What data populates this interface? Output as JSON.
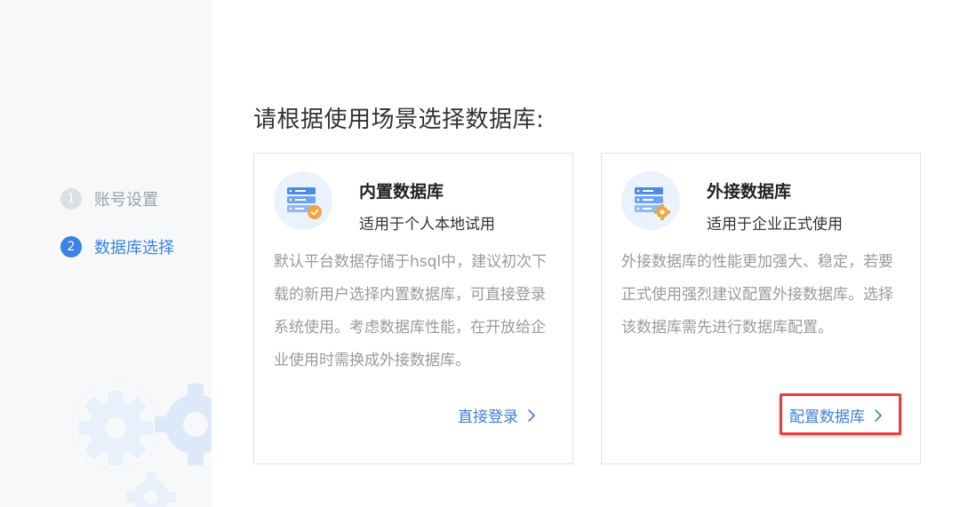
{
  "steps": [
    {
      "number": "1",
      "label": "账号设置",
      "state": "inactive"
    },
    {
      "number": "2",
      "label": "数据库选择",
      "state": "active"
    }
  ],
  "main": {
    "title": "请根据使用场景选择数据库:"
  },
  "cards": [
    {
      "title": "内置数据库",
      "subtitle": "适用于个人本地试用",
      "icon": "database-check-icon",
      "description": "默认平台数据存储于hsql中，建议初次下载的新用户选择内置数据库，可直接登录系统使用。考虑数据库性能，在开放给企业使用时需换成外接数据库。",
      "action": "直接登录"
    },
    {
      "title": "外接数据库",
      "subtitle": "适用于企业正式使用",
      "icon": "database-gear-icon",
      "description": "外接数据库的性能更加强大、稳定，若要正式使用强烈建议配置外接数据库。选择该数据库需先进行数据库配置。",
      "action": "配置数据库"
    }
  ],
  "colors": {
    "accent": "#3d82e6",
    "link": "#3d7fd9",
    "highlight": "#e53e3e",
    "icon_bg": "#eaf2fd",
    "icon_blue": "#4a8ae8",
    "badge_orange": "#f5a33c"
  }
}
